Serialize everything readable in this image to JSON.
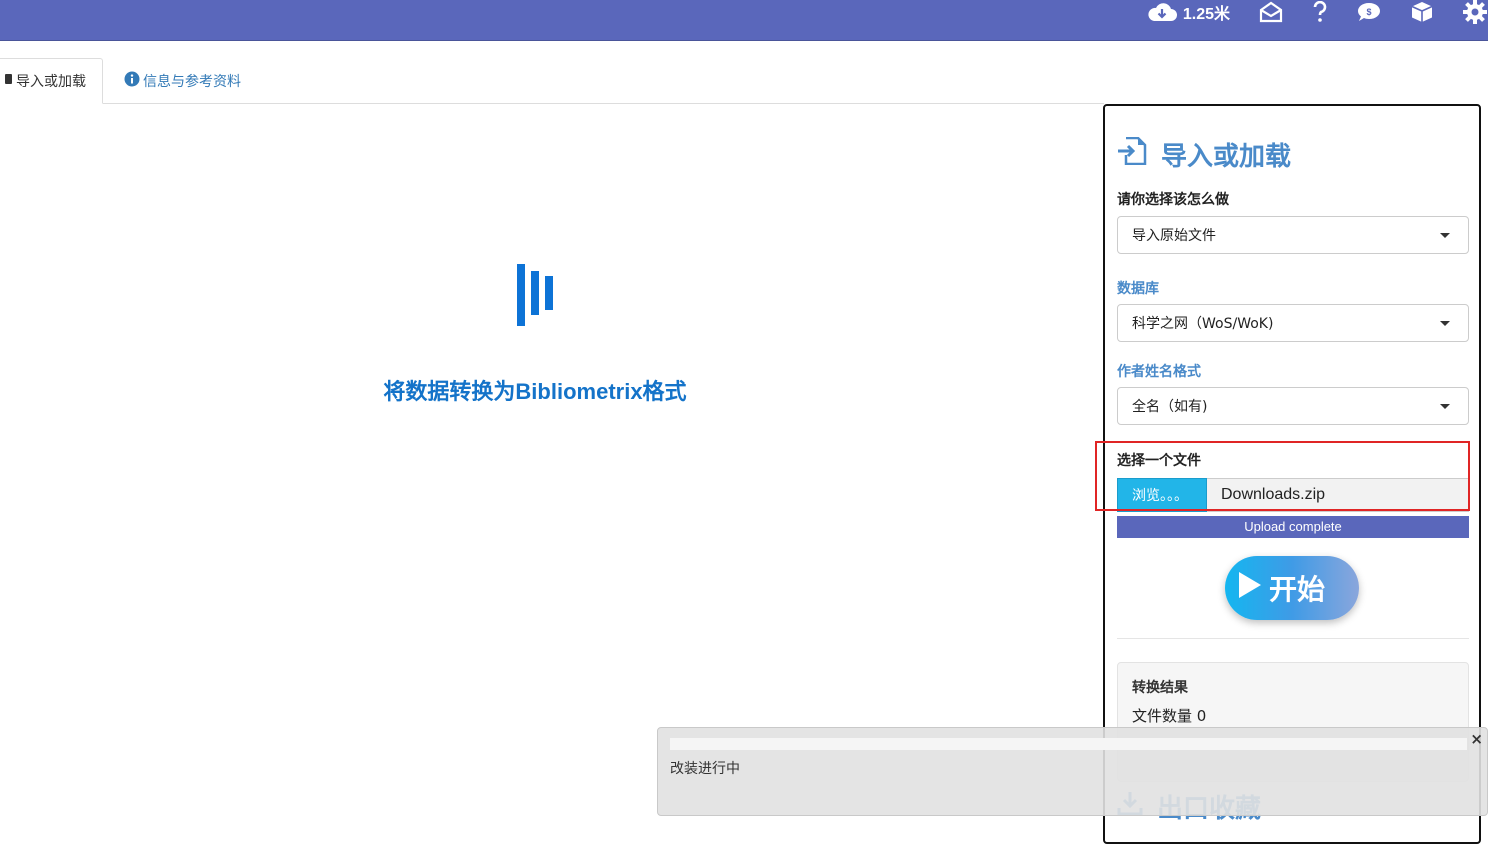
{
  "header": {
    "download_label": "1.25米",
    "icons": [
      "cloud-download-icon",
      "envelope-open-icon",
      "question-icon",
      "comment-dollar-icon",
      "cube-icon",
      "gear-icon"
    ]
  },
  "tabs": [
    {
      "label": "导入或加载",
      "active": true
    },
    {
      "label": "信息与参考资料",
      "active": false
    }
  ],
  "main": {
    "title": "将数据转换为Bibliometrix格式"
  },
  "panel": {
    "title": "导入或加载",
    "action_label": "请你选择该怎么做",
    "action_value": "导入原始文件",
    "database_label": "数据库",
    "database_value": "科学之网（WoS/WoK)",
    "author_label": "作者姓名格式",
    "author_value": "全名（如有)",
    "file_label": "选择一个文件",
    "browse_label": "浏览。。。",
    "file_name": "Downloads.zip",
    "upload_status": "Upload complete",
    "start_label": "开始",
    "result_title": "转换结果",
    "file_count": "文件数量 0",
    "export_title": "出口收藏"
  },
  "notification": {
    "text": "改装进行中",
    "close": "×"
  },
  "colors": {
    "header_bg": "#5a67bb",
    "accent_blue": "#4a8ac9",
    "title_blue": "#1473c9",
    "highlight_red": "#e02525"
  }
}
